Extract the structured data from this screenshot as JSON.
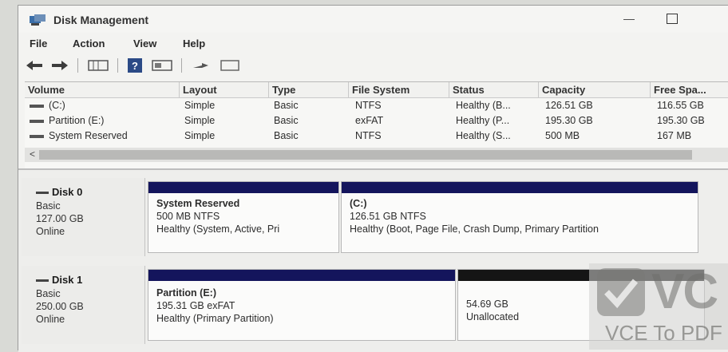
{
  "window": {
    "title": "Disk Management",
    "minimize_glyph": "—"
  },
  "menu": [
    "File",
    "Action",
    "View",
    "Help"
  ],
  "toolbar": {
    "icons": [
      "back-arrow-icon",
      "forward-arrow-icon",
      "list-view-icon",
      "help-icon",
      "properties-icon",
      "settings-icon",
      "console-icon"
    ]
  },
  "volume_table": {
    "columns": [
      "Volume",
      "Layout",
      "Type",
      "File System",
      "Status",
      "Capacity",
      "Free Spa..."
    ],
    "rows": [
      [
        "(C:)",
        "Simple",
        "Basic",
        "NTFS",
        "Healthy (B...",
        "126.51 GB",
        "116.55 GB"
      ],
      [
        "Partition (E:)",
        "Simple",
        "Basic",
        "exFAT",
        "Healthy (P...",
        "195.30 GB",
        "195.30 GB"
      ],
      [
        "System Reserved",
        "Simple",
        "Basic",
        "NTFS",
        "Healthy (S...",
        "500 MB",
        "167 MB"
      ]
    ],
    "scroll_left_glyph": "<"
  },
  "disks": [
    {
      "name": "Disk 0",
      "kind": "Basic",
      "size": "127.00 GB",
      "state": "Online",
      "partitions": [
        {
          "label": "System Reserved",
          "detail": "500 MB NTFS",
          "status": "Healthy (System, Active, Pri",
          "bar_color": "#14155c"
        },
        {
          "label": "(C:)",
          "detail": "126.51 GB NTFS",
          "status": "Healthy (Boot, Page File, Crash Dump, Primary Partition",
          "bar_color": "#14155c"
        }
      ]
    },
    {
      "name": "Disk 1",
      "kind": "Basic",
      "size": "250.00 GB",
      "state": "Online",
      "partitions": [
        {
          "label": "Partition (E:)",
          "detail": "195.31 GB exFAT",
          "status": "Healthy (Primary Partition)",
          "bar_color": "#14155c"
        },
        {
          "label": "",
          "detail": "54.69 GB",
          "status": "Unallocated",
          "bar_color": "#151515"
        }
      ]
    }
  ],
  "watermark": {
    "logo_text": "VC",
    "text": "VCE To PDF"
  }
}
